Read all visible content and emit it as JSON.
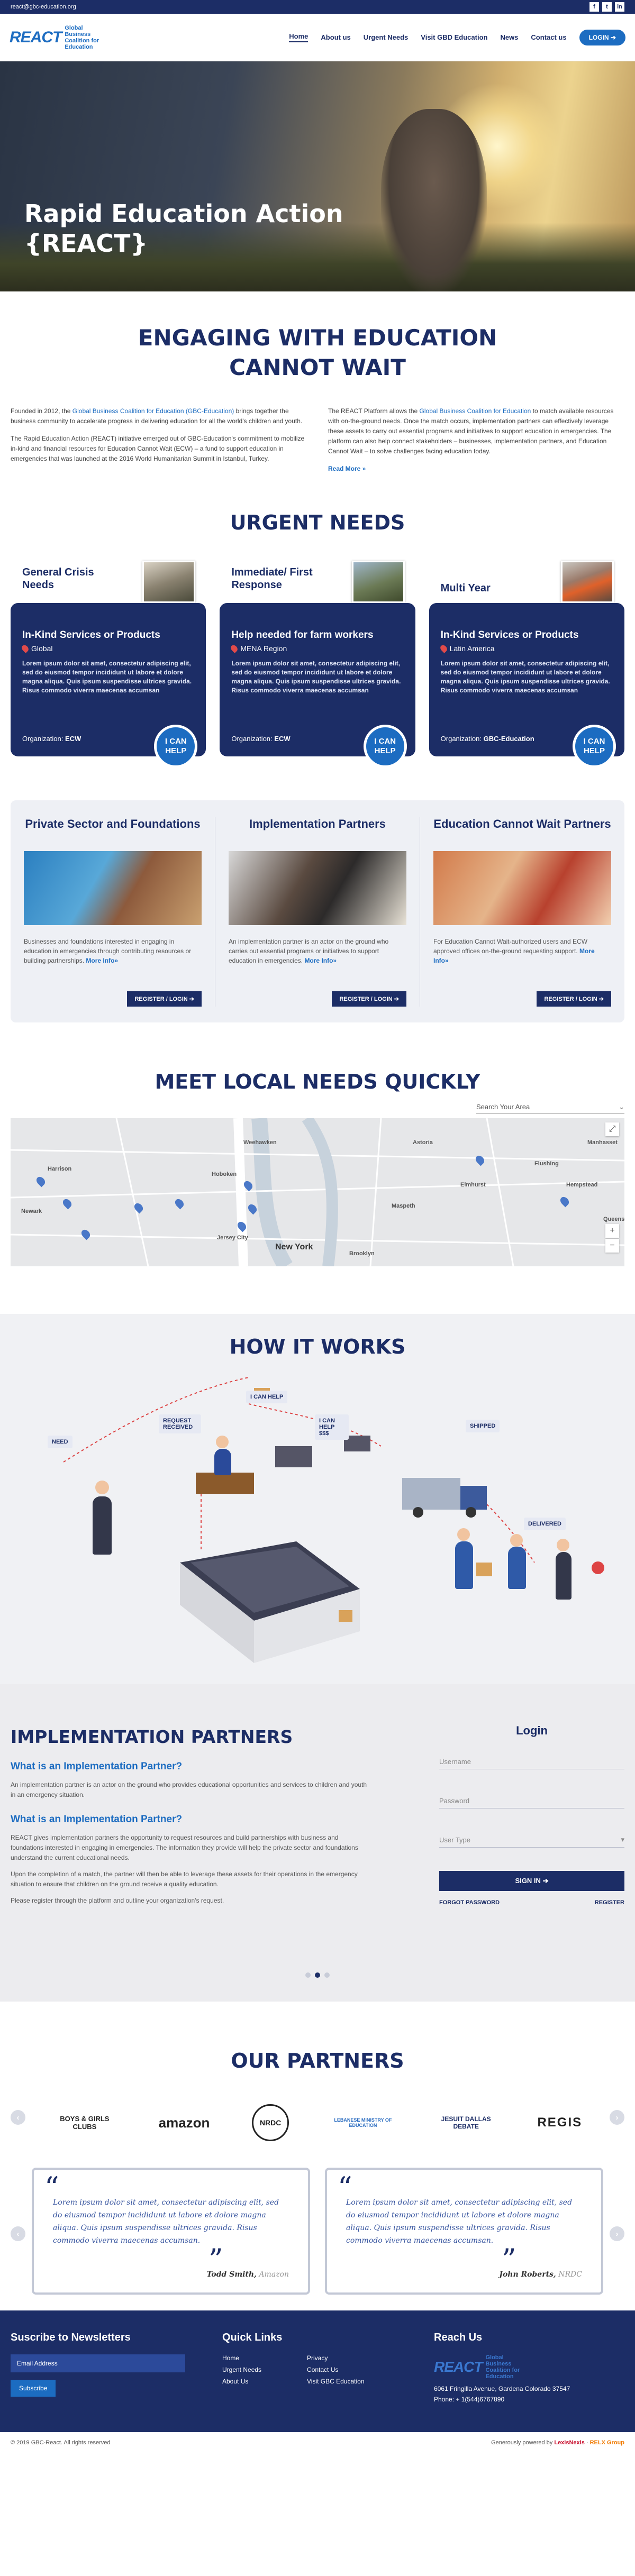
{
  "topbar": {
    "email": "react@gbc-education.org",
    "social": [
      "f",
      "t",
      "in"
    ]
  },
  "header": {
    "logo_big": "REACT",
    "logo_small": "Global Business Coalition for Education",
    "nav": [
      "Home",
      "About us",
      "Urgent Needs",
      "Visit GBD Education",
      "News",
      "Contact us"
    ],
    "login": "LOGIN"
  },
  "hero": {
    "title_line1": "Rapid Education Action",
    "title_line2": "{REACT}"
  },
  "engaging": {
    "title_line1": "ENGAGING WITH EDUCATION",
    "title_line2": "CANNOT WAIT",
    "p1_a": "Founded in 2012, the ",
    "p1_link": "Global Business Coalition for Education (GBC-Education)",
    "p1_b": " brings together the business community to accelerate progress in delivering education for all the world's children and youth.",
    "p2": "The Rapid Education Action (REACT) initiative emerged out of GBC-Education's commitment to mobilize in-kind and financial resources for Education Cannot Wait (ECW) – a fund to support education in emergencies that was launched at the 2016 World Humanitarian Summit in Istanbul, Turkey.",
    "p3_a": "The REACT Platform allows the ",
    "p3_link": "Global Business Coalition for Education",
    "p3_b": " to match available resources with on-the-ground needs. Once the match occurs, implementation partners can effectively leverage these assets to carry out essential programs and initiatives to support education in emergencies. The platform can also help connect stakeholders – businesses, implementation partners, and Education Cannot Wait – to solve challenges facing education today.",
    "readmore": "Read More »"
  },
  "urgent": {
    "title": "URGENT NEEDS",
    "cards": [
      {
        "category": "General Crisis Needs",
        "heading": "In-Kind Services or Products",
        "location": "Global",
        "desc": "Lorem ipsum dolor sit amet, consectetur adipiscing elit, sed do eiusmod tempor incididunt ut labore et dolore magna aliqua. Quis ipsum suspendisse ultrices gravida. Risus commodo viverra maecenas accumsan",
        "org_label": "Organization:",
        "org": "ECW",
        "help": "I CAN HELP"
      },
      {
        "category": "Immediate/ First Response",
        "heading": "Help needed for farm workers",
        "location": "MENA Region",
        "desc": "Lorem ipsum dolor sit amet, consectetur adipiscing elit, sed do eiusmod tempor incididunt ut labore et dolore magna aliqua. Quis ipsum suspendisse ultrices gravida. Risus commodo viverra maecenas accumsan",
        "org_label": "Organization:",
        "org": "ECW",
        "help": "I CAN HELP"
      },
      {
        "category": "Multi Year",
        "heading": "In-Kind Services or Products",
        "location": "Latin America",
        "desc": "Lorem ipsum dolor sit amet, consectetur adipiscing elit, sed do eiusmod tempor incididunt ut labore et dolore magna aliqua. Quis ipsum suspendisse ultrices gravida. Risus commodo viverra maecenas accumsan",
        "org_label": "Organization:",
        "org": "GBC-Education",
        "help": "I CAN HELP"
      }
    ]
  },
  "ptypes": [
    {
      "title": "Private Sector and Foundations",
      "desc": "Businesses and foundations interested in engaging in education in emergencies through contributing resources or building partnerships.",
      "more": "More Info»",
      "btn": "REGISTER / LOGIN"
    },
    {
      "title": "Implementation Partners",
      "desc": "An implementation partner is an actor on the ground who carries out essential programs or initiatives to support education in emergencies.",
      "more": "More Info»",
      "btn": "REGISTER / LOGIN"
    },
    {
      "title": "Education Cannot Wait Partners",
      "desc": "For Education Cannot Wait-authorized users and ECW approved offices on-the-ground requesting support.",
      "more": "More Info»",
      "btn": "REGISTER / LOGIN"
    }
  ],
  "mapsec": {
    "title": "MEET LOCAL NEEDS QUICKLY",
    "search": "Search Your Area",
    "labels": [
      "Newark",
      "Jersey City",
      "New York",
      "Hoboken",
      "Astoria",
      "Flushing",
      "Weehawken",
      "Harrison",
      "Elmhurst",
      "Queens",
      "Maspeth",
      "Manhasset",
      "Hempstead",
      "Brooklyn"
    ]
  },
  "how": {
    "title": "HOW IT WORKS",
    "tags": [
      "I CAN HELP",
      "I CAN HELP $$$",
      "REQUEST RECEIVED",
      "NEED",
      "SHIPPED",
      "DELIVERED"
    ]
  },
  "impl": {
    "title": "IMPLEMENTATION PARTNERS",
    "q1": "What is an Implementation Partner?",
    "a1": "An implementation partner is an actor on the ground who provides educational opportunities and services to children and youth in an emergency situation.",
    "q2": "What is an Implementation Partner?",
    "a2": "REACT gives implementation partners the opportunity to request resources and build partnerships with business and foundations interested in engaging in emergencies. The information they provide will help the private sector and foundations understand the current educational needs.",
    "a3": "Upon the completion of a match, the partner will then be able to leverage these assets for their operations in the emergency situation to ensure that children on the ground receive a quality education.",
    "a4": "Please register through the platform and outline your organization's request."
  },
  "login": {
    "title": "Login",
    "username": "Username",
    "password": "Password",
    "usertype": "User Type",
    "signin": "SIGN IN",
    "forgot": "FORGOT PASSWORD",
    "register": "REGISTER"
  },
  "ourp": {
    "title": "OUR PARTNERS",
    "logos": [
      "BOYS & GIRLS CLUBS",
      "amazon",
      "NRDC",
      "LEBANESE MINISTRY OF EDUCATION",
      "JESUIT DALLAS DEBATE",
      "REGIS"
    ],
    "tests": [
      {
        "text": "Lorem ipsum dolor sit amet, consectetur adipiscing elit, sed do eiusmod tempor incididunt ut labore et dolore magna aliqua. Quis ipsum suspendisse ultrices gravida. Risus commodo viverra maecenas accumsan.",
        "name": "Todd Smith,",
        "org": "Amazon"
      },
      {
        "text": "Lorem ipsum dolor sit amet, consectetur adipiscing elit, sed do eiusmod tempor incididunt ut labore et dolore magna aliqua. Quis ipsum suspendisse ultrices gravida. Risus commodo viverra maecenas accumsan.",
        "name": "John Roberts,",
        "org": "NRDC"
      }
    ]
  },
  "footer": {
    "news_title": "Suscribe to Newsletters",
    "email_ph": "Email Address",
    "subscribe": "Subscribe",
    "ql_title": "Quick Links",
    "ql": [
      "Home",
      "Privacy",
      "Urgent Needs",
      "Contact Us",
      "About Us",
      "Visit GBC Education"
    ],
    "reach_title": "Reach Us",
    "address": "6061 Fringilla Avenue, Gardena Colorado 37547",
    "phone": "Phone: + 1(544)6767890"
  },
  "copy": {
    "left": "© 2019 GBC-React. All rights reserved",
    "right": "Generously powered by",
    "brand1": "LexisNexis",
    "brand2": "RELX Group"
  }
}
